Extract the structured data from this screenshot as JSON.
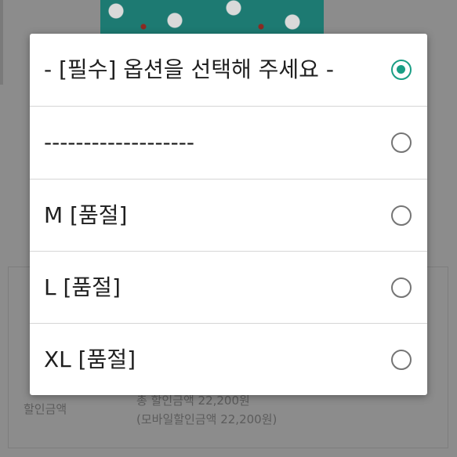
{
  "dialog": {
    "options": [
      {
        "label": "- [필수] 옵션을 선택해 주세요 -",
        "selected": true
      },
      {
        "label": "-------------------",
        "selected": false
      },
      {
        "label": "M [품절]",
        "selected": false
      },
      {
        "label": "L [품절]",
        "selected": false
      },
      {
        "label": "XL [품절]",
        "selected": false
      }
    ]
  },
  "background": {
    "discount_label": "할인금액",
    "total_discount": "총 할인금액 22,200원",
    "mobile_discount": "(모바일할인금액 22,200원)"
  },
  "colors": {
    "accent": "#1a9e85",
    "scrim": "#8c8c8c",
    "dialog_bg": "#ffffff"
  }
}
